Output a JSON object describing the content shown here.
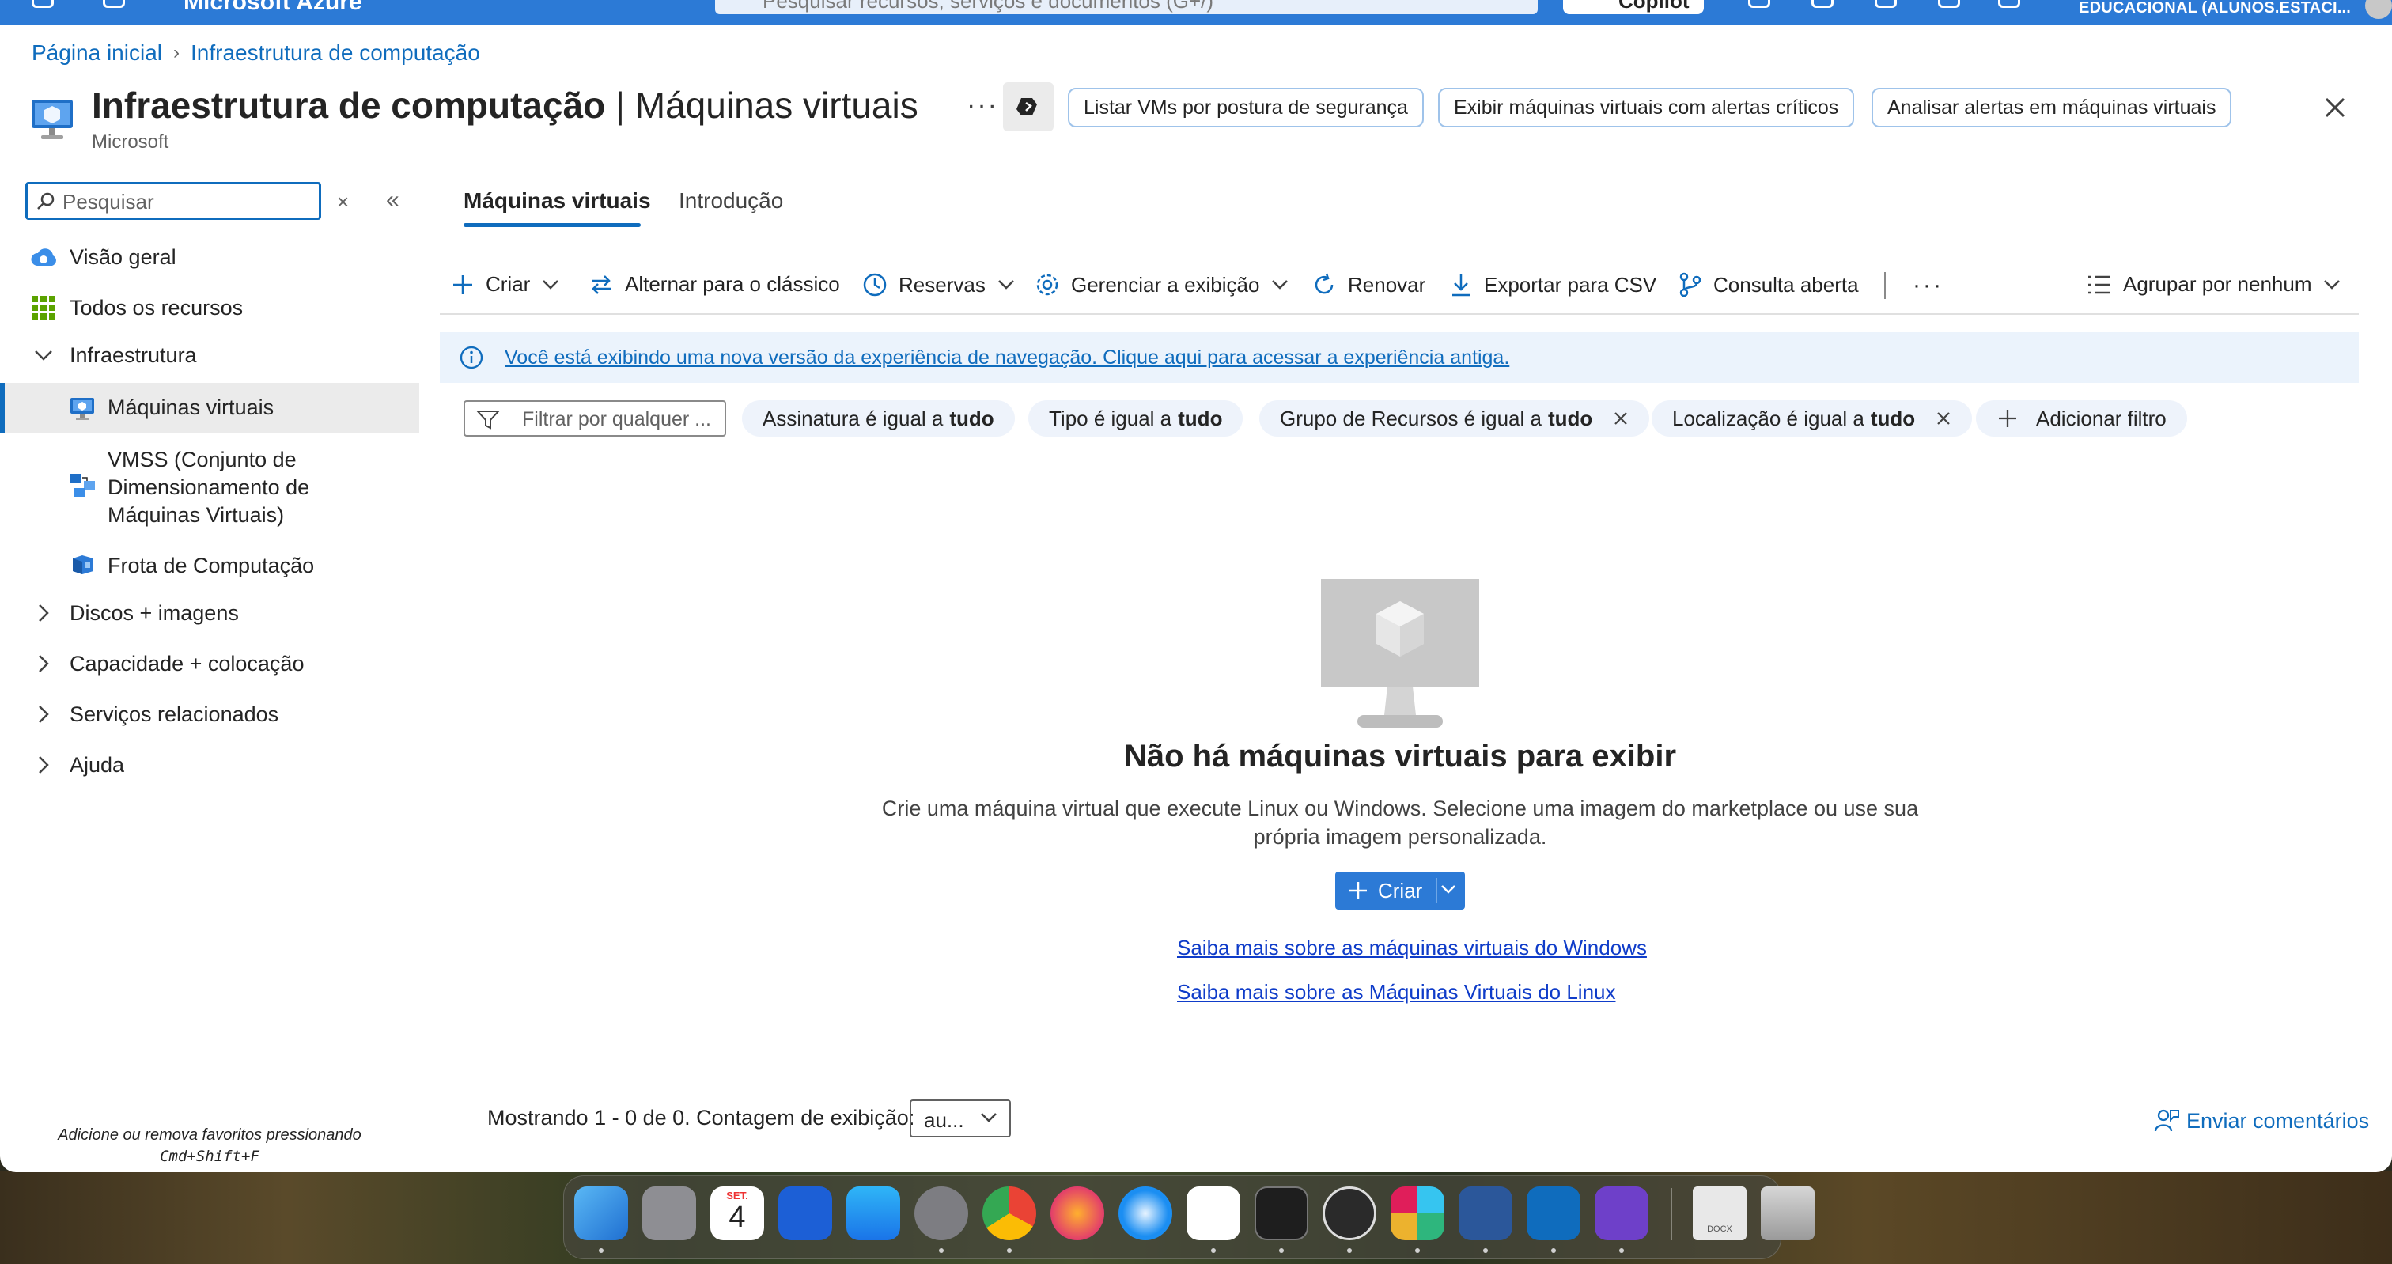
{
  "topbar": {
    "brand": "Microsoft Azure",
    "search_placeholder": "Pesquisar recursos, serviços e documentos (G+/)",
    "copilot_label": "Copilot",
    "tenant": "EDUCACIONAL (ALUNOS.ESTACI..."
  },
  "breadcrumb": {
    "home": "Página inicial",
    "current": "Infraestrutura de computação"
  },
  "header": {
    "title_bold": "Infraestrutura de computação",
    "title_sep": " | ",
    "title_rest": "Máquinas virtuais",
    "subtitle": "Microsoft",
    "ellipsis": "···",
    "actions": [
      "Listar VMs por postura de segurança",
      "Exibir máquinas virtuais com alertas críticos",
      "Analisar alertas em máquinas virtuais"
    ]
  },
  "sidebar": {
    "search_placeholder": "Pesquisar",
    "clear_glyph": "×",
    "collapse_glyph": "«",
    "items": {
      "overview": "Visão geral",
      "all_resources": "Todos os recursos",
      "infrastructure": "Infraestrutura",
      "virtual_machines": "Máquinas virtuais",
      "vmss_line1": "VMSS (Conjunto de",
      "vmss_line2": "Dimensionamento de",
      "vmss_line3": "Máquinas Virtuais)",
      "compute_fleet": "Frota de Computação",
      "disks_images": "Discos + imagens",
      "capacity": "Capacidade + colocação",
      "related": "Serviços relacionados",
      "help": "Ajuda"
    },
    "fav_hint_text": "Adicione ou remova favoritos pressionando",
    "fav_hint_keys": "Cmd+Shift+F"
  },
  "tabs": {
    "vms": "Máquinas virtuais",
    "intro": "Introdução"
  },
  "commands": {
    "create": "Criar",
    "switch_classic": "Alternar para o clássico",
    "reservations": "Reservas",
    "manage_view": "Gerenciar a exibição",
    "refresh": "Renovar",
    "export_csv": "Exportar para CSV",
    "open_query": "Consulta aberta",
    "more": "···",
    "group_by": "Agrupar por nenhum"
  },
  "banner": {
    "text": "Você está exibindo uma nova versão da experiência de navegação. Clique aqui para acessar a experiência antiga."
  },
  "filters": {
    "placeholder": "Filtrar por qualquer ...",
    "chips": {
      "subscription_label": "Assinatura é igual a",
      "subscription_value": "tudo",
      "type_label": "Tipo é igual a",
      "type_value": "tudo",
      "rg_label": "Grupo de Recursos é igual a",
      "rg_value": "tudo",
      "location_label": "Localização é igual a",
      "location_value": "tudo"
    },
    "add_filter": "Adicionar filtro"
  },
  "empty_state": {
    "title": "Não há máquinas virtuais para exibir",
    "description": "Crie uma máquina virtual que execute Linux ou Windows. Selecione uma imagem do marketplace ou use sua própria imagem personalizada.",
    "create_button": "Criar",
    "link_windows": "Saiba mais sobre as máquinas virtuais do Windows",
    "link_linux": "Saiba mais sobre as Máquinas Virtuais do Linux"
  },
  "footer": {
    "showing": "Mostrando 1 - 0 de 0. Contagem de exibição:",
    "count_value": "au...",
    "feedback": "Enviar comentários"
  },
  "dock": {
    "calendar_month": "SET.",
    "calendar_day": "4",
    "doc_label": "DOCX"
  },
  "colors": {
    "azure_blue": "#2c7ad6",
    "link_blue": "#0f6cbd",
    "chip_bg": "#eef3fb",
    "banner_bg": "#ebf3fc",
    "selected_bg": "#ebebeb"
  }
}
